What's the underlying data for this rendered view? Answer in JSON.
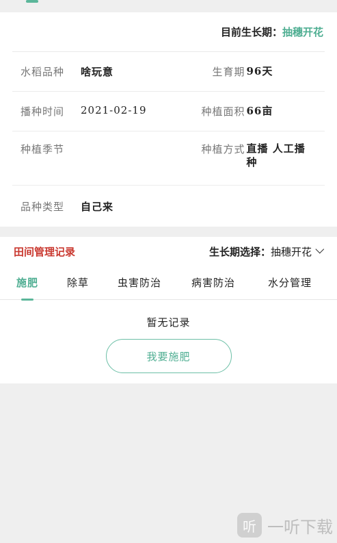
{
  "current_stage": {
    "label": "目前生长期：",
    "value": "抽穗开花"
  },
  "info": {
    "variety_label": "水稻品种",
    "variety_value": "啥玩意",
    "growth_label": "生育期",
    "growth_value": "96天",
    "sow_time_label": "播种时间",
    "sow_time_value": "2021-02-19",
    "area_label": "种植面积",
    "area_value": "66亩",
    "season_label": "种植季节",
    "season_value": "",
    "method_label": "种植方式",
    "method_value": "直播 人工播种",
    "type_label": "品种类型",
    "type_value": "自己来"
  },
  "records": {
    "title": "田间管理记录",
    "stage_select_label": "生长期选择：",
    "stage_select_value": "抽穗开花",
    "tabs": [
      "施肥",
      "除草",
      "虫害防治",
      "病害防治",
      "水分管理"
    ],
    "active_tab": 0,
    "empty_text": "暂无记录",
    "action_button": "我要施肥"
  },
  "watermark": {
    "logo_glyph": "听",
    "text": "一听下载"
  },
  "colors": {
    "accent": "#4fae92",
    "title_red": "#c9382f",
    "background": "#efefef"
  }
}
